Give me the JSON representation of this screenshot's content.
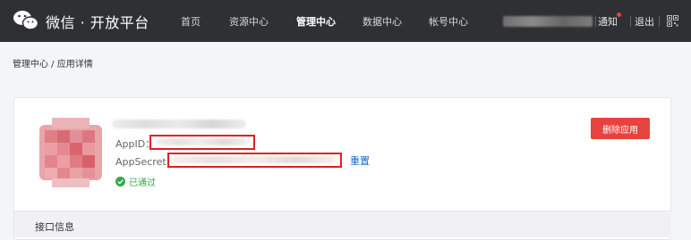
{
  "header": {
    "logo_text": "微信 · 开放平台",
    "nav": [
      "首页",
      "资源中心",
      "管理中心",
      "数据中心",
      "帐号中心"
    ],
    "notice_label": "通知",
    "logout_label": "退出"
  },
  "breadcrumb": "管理中心 / 应用详情",
  "app": {
    "appid_label": "AppID：",
    "appsecret_label": "AppSecret：",
    "reset_label": "重置",
    "status_label": "已通过",
    "delete_label": "删除应用"
  },
  "section": {
    "title": "接口信息"
  },
  "colors": {
    "topbar": "#2f3033",
    "danger": "#e64340",
    "link": "#1a6cc4",
    "success": "#35a64b"
  }
}
